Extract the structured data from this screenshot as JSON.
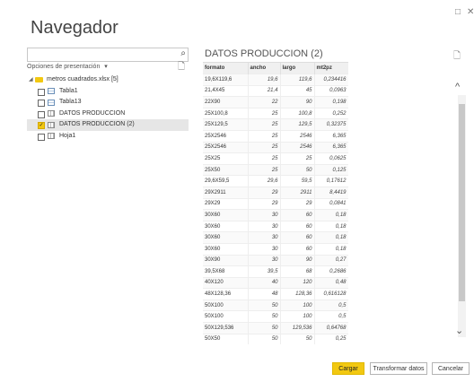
{
  "window": {
    "title": "Navegador",
    "restore_glyph": "□",
    "close_glyph": "✕"
  },
  "left": {
    "search": {
      "value": "",
      "placeholder": ""
    },
    "options_label": "Opciones de presentación",
    "options_caret": "▾",
    "tree": [
      {
        "label": "metros cuadrados.xlsx [5]",
        "type": "folder",
        "level": 0,
        "checked": false,
        "selected": false
      },
      {
        "label": "Tabla1",
        "type": "table",
        "level": 1,
        "checked": false,
        "selected": false
      },
      {
        "label": "Tabla13",
        "type": "table",
        "level": 1,
        "checked": false,
        "selected": false
      },
      {
        "label": "DATOS PRODUCCION",
        "type": "sheet",
        "level": 1,
        "checked": false,
        "selected": false
      },
      {
        "label": "DATOS PRODUCCION (2)",
        "type": "sheet",
        "level": 1,
        "checked": true,
        "selected": true
      },
      {
        "label": "Hoja1",
        "type": "sheet",
        "level": 1,
        "checked": false,
        "selected": false
      }
    ]
  },
  "preview": {
    "title": "DATOS PRODUCCION (2)",
    "columns": [
      "formato",
      "ancho",
      "largo",
      "mt2pz"
    ],
    "rows": [
      [
        "19,6X119,6",
        "19,6",
        "119,6",
        "0,234416"
      ],
      [
        "21,4X45",
        "21,4",
        "45",
        "0,0963"
      ],
      [
        "22X90",
        "22",
        "90",
        "0,198"
      ],
      [
        "25X100,8",
        "25",
        "100,8",
        "0,252"
      ],
      [
        "25X129,5",
        "25",
        "129,5",
        "0,32375"
      ],
      [
        "25X2546",
        "25",
        "2546",
        "6,365"
      ],
      [
        "25X2546",
        "25",
        "2546",
        "6,365"
      ],
      [
        "25X25",
        "25",
        "25",
        "0,0625"
      ],
      [
        "25X50",
        "25",
        "50",
        "0,125"
      ],
      [
        "29,6X59,5",
        "29,6",
        "59,5",
        "0,17612"
      ],
      [
        "29X2911",
        "29",
        "2911",
        "8,4419"
      ],
      [
        "29X29",
        "29",
        "29",
        "0,0841"
      ],
      [
        "30X60",
        "30",
        "60",
        "0,18"
      ],
      [
        "30X60",
        "30",
        "60",
        "0,18"
      ],
      [
        "30X60",
        "30",
        "60",
        "0,18"
      ],
      [
        "30X60",
        "30",
        "60",
        "0,18"
      ],
      [
        "30X90",
        "30",
        "90",
        "0,27"
      ],
      [
        "39,5X68",
        "39,5",
        "68",
        "0,2686"
      ],
      [
        "40X120",
        "40",
        "120",
        "0,48"
      ],
      [
        "48X128,36",
        "48",
        "128,36",
        "0,616128"
      ],
      [
        "50X100",
        "50",
        "100",
        "0,5"
      ],
      [
        "50X100",
        "50",
        "100",
        "0,5"
      ],
      [
        "50X129,536",
        "50",
        "129,536",
        "0,64768"
      ],
      [
        "50X50",
        "50",
        "50",
        "0,25"
      ]
    ]
  },
  "scrollbar": {
    "up_glyph": "^",
    "down_glyph": "⌄"
  },
  "footer": {
    "load_label": "Cargar",
    "transform_label": "Transformar datos",
    "cancel_label": "Cancelar"
  },
  "colors": {
    "accent": "#f2c811"
  }
}
